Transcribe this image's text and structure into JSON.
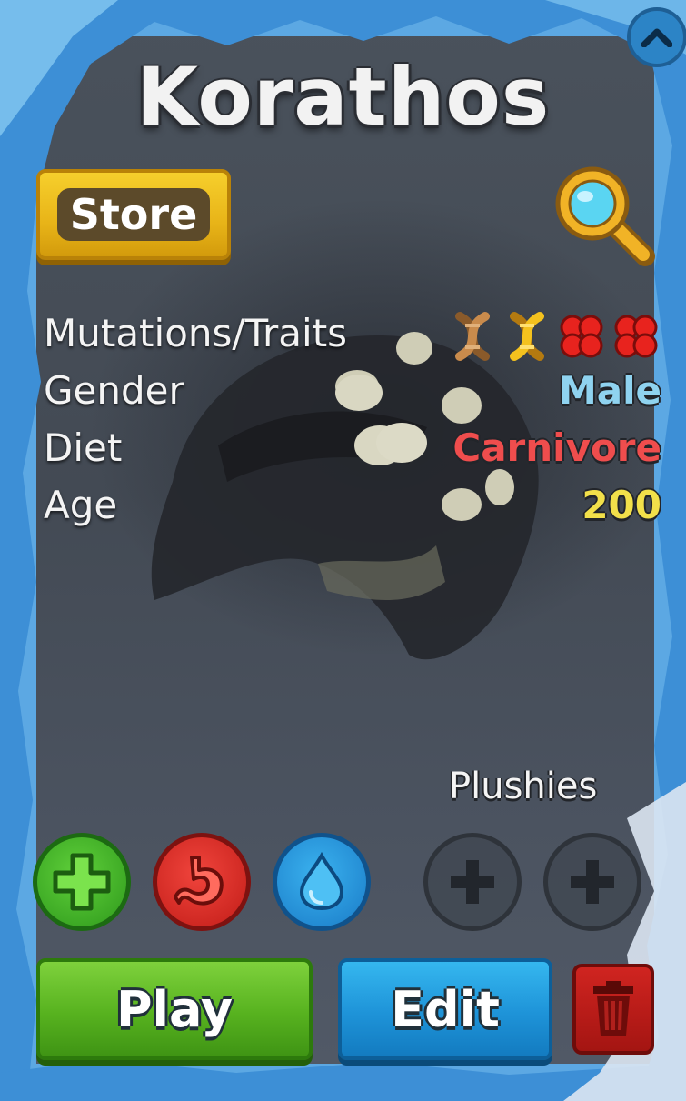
{
  "dino": {
    "name": "Korathos"
  },
  "header": {
    "store_label": "Store",
    "search_icon": "magnifier-icon",
    "collapse_icon": "chevron-up-icon"
  },
  "stats": {
    "traits_label": "Mutations/Traits",
    "traits_icons": [
      "dna-brown-icon",
      "dna-gold-icon",
      "cells-red-icon",
      "cells-red-icon"
    ],
    "gender_label": "Gender",
    "gender_value": "Male",
    "diet_label": "Diet",
    "diet_value": "Carnivore",
    "age_label": "Age",
    "age_value": "200"
  },
  "colors": {
    "gender": "#8fd3f0",
    "diet": "#ef4d4d",
    "age": "#f2e04a"
  },
  "plushies": {
    "label": "Plushies",
    "slot_icon": "plus-icon"
  },
  "needs": {
    "health_icon": "health-cross-icon",
    "hunger_icon": "stomach-icon",
    "thirst_icon": "water-drop-icon"
  },
  "actions": {
    "play_label": "Play",
    "edit_label": "Edit",
    "delete_icon": "trash-icon"
  }
}
